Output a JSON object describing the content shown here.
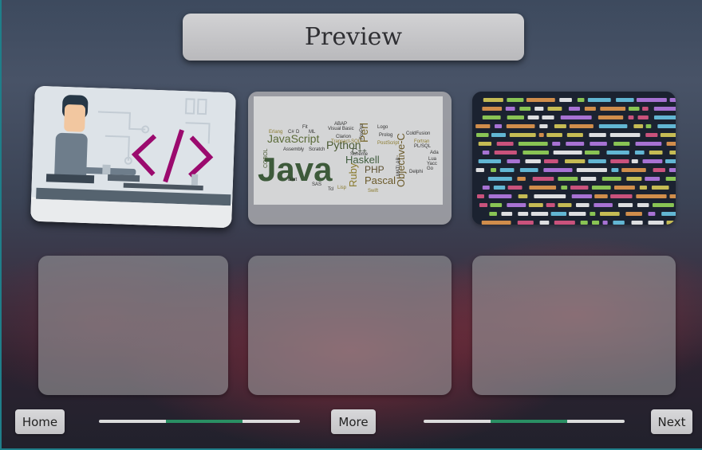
{
  "page": {
    "title": "Preview"
  },
  "cards": [
    {
      "icon": "developer-illustration-icon",
      "filled": true
    },
    {
      "icon": "programming-word-cloud-icon",
      "filled": true,
      "words": [
        "Java",
        "JavaScript",
        "Python",
        "Perl",
        "Haskell",
        "Ruby",
        "PHP",
        "Pascal",
        "Objective-C",
        "C++",
        "COBOL",
        "Erlang",
        "ABAP",
        "Visual Basic",
        "ColdFusion",
        "Prolog",
        "Logo",
        "Clarion",
        "FoxPro",
        "Scheme",
        "Assembly",
        "Scratch",
        "Transact-SQL",
        "PostScript",
        "PL/SQL",
        "Fortran",
        "Lisp",
        "SAS",
        "Delphi",
        "MATLAB",
        "Swift",
        "Ada",
        "Lua",
        "Yacc",
        "Dart",
        "Go",
        "ML",
        "Fit",
        "C#",
        "D",
        "Tcl"
      ]
    },
    {
      "icon": "code-screen-photo-icon",
      "filled": true
    },
    {
      "filled": false
    },
    {
      "filled": false
    },
    {
      "filled": false
    }
  ],
  "controls": {
    "home_label": "Home",
    "more_label": "More",
    "next_label": "Next"
  },
  "progress": {
    "left": {
      "start": 0.33,
      "end": 0.71
    },
    "right": {
      "start": 0.33,
      "end": 0.71
    }
  },
  "colors": {
    "accent": "#2a8f63",
    "frame": "#1f7f8a",
    "code_pink": "#9b0a6e"
  }
}
